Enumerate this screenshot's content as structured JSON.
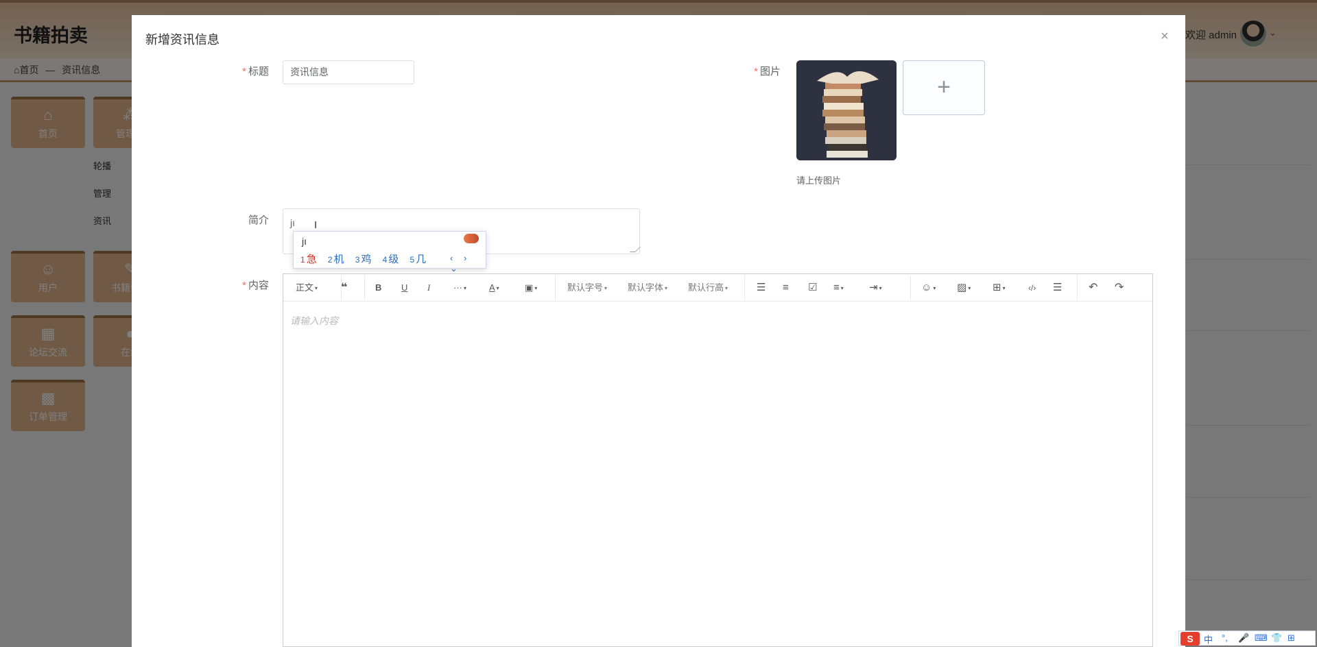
{
  "app": {
    "brand": "书籍拍卖",
    "welcome": "欢迎 admin",
    "breadcrumb": {
      "home": "首页",
      "sep": "—",
      "current": "资讯信息"
    }
  },
  "sidebar": {
    "tiles": [
      {
        "label": "首页",
        "icon": "home-icon"
      },
      {
        "label": "管理员",
        "icon": "admin-icon"
      },
      {
        "label": "用户",
        "icon": "user-icon"
      },
      {
        "label": "书籍信息",
        "icon": "book-icon"
      },
      {
        "label": "论坛交流",
        "icon": "forum-icon"
      },
      {
        "label": "在线",
        "icon": "chat-icon"
      },
      {
        "label": "订单管理",
        "icon": "order-icon"
      }
    ],
    "subitems": [
      "轮播",
      "管理",
      "资讯"
    ]
  },
  "dialog": {
    "title": "新增资讯信息",
    "close": "×",
    "fields": {
      "title_label": "标题",
      "title_value": "资讯信息",
      "pic_label": "图片",
      "pic_tip": "请上传图片",
      "upload_plus": "+",
      "summary_label": "简介",
      "summary_value": "jı",
      "content_label": "内容",
      "content_placeholder": "请输入内容",
      "required_mark": "*"
    }
  },
  "ime": {
    "pinyin": "jı",
    "candidates": [
      {
        "n": "1",
        "text": "急"
      },
      {
        "n": "2",
        "text": "机"
      },
      {
        "n": "3",
        "text": "鸡"
      },
      {
        "n": "4",
        "text": "级"
      },
      {
        "n": "5",
        "text": "几"
      }
    ],
    "nav": "‹ › ⌄"
  },
  "toolbar": {
    "paragraph": "正文",
    "font_size": "默认字号",
    "font_family": "默认字体",
    "line_height": "默认行高",
    "more": "···"
  },
  "imebar": {
    "logo": "S",
    "items": [
      "中",
      "°,",
      "🎤",
      "⌨",
      "👕",
      "⊞"
    ]
  }
}
